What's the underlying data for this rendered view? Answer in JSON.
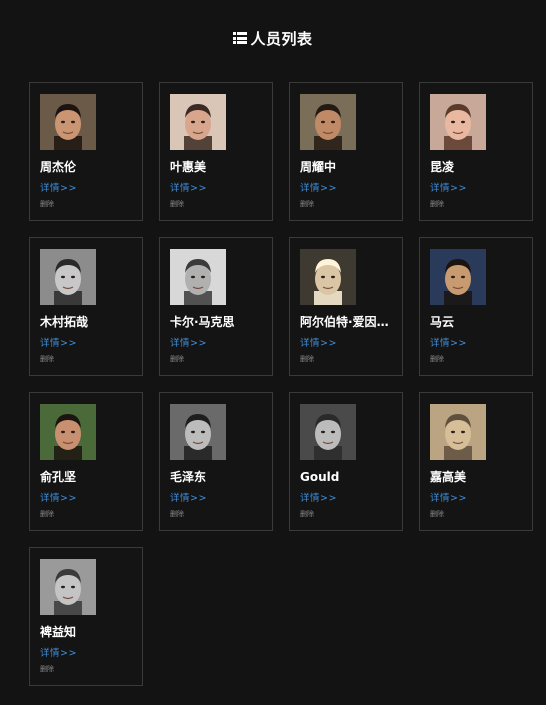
{
  "header": {
    "icon": "list-icon",
    "title": "人员列表"
  },
  "people": [
    {
      "name": "周杰伦",
      "details_label": "详情>>",
      "delete_label": "删除",
      "photo": {
        "bg": "#6b5a48",
        "skin": "#c99572",
        "hair": "#1c1410",
        "tone": "color"
      }
    },
    {
      "name": "叶惠美",
      "details_label": "详情>>",
      "delete_label": "删除",
      "photo": {
        "bg": "#d9c6b6",
        "skin": "#d8a68c",
        "hair": "#3a2a22",
        "tone": "color"
      }
    },
    {
      "name": "周耀中",
      "details_label": "详情>>",
      "delete_label": "删除",
      "photo": {
        "bg": "#7a6e58",
        "skin": "#c08a66",
        "hair": "#231a14",
        "tone": "color"
      }
    },
    {
      "name": "昆凌",
      "details_label": "详情>>",
      "delete_label": "删除",
      "photo": {
        "bg": "#c8a898",
        "skin": "#e8b8a0",
        "hair": "#5a3a2a",
        "tone": "color"
      }
    },
    {
      "name": "木村拓哉",
      "details_label": "详情>>",
      "delete_label": "删除",
      "photo": {
        "bg": "#8c8c8c",
        "skin": "#c8c8c8",
        "hair": "#2a2a2a",
        "tone": "gray"
      }
    },
    {
      "name": "卡尔·马克思",
      "details_label": "详情>>",
      "delete_label": "删除",
      "photo": {
        "bg": "#d8d8d8",
        "skin": "#b0b0b0",
        "hair": "#3a3a3a",
        "tone": "gray"
      }
    },
    {
      "name": "阿尔伯特·爱因斯坦",
      "details_label": "详情>>",
      "delete_label": "删除",
      "photo": {
        "bg": "#3a3630",
        "skin": "#c8b8a0",
        "hair": "#e8e4dc",
        "tone": "sepia"
      }
    },
    {
      "name": "马云",
      "details_label": "详情>>",
      "delete_label": "删除",
      "photo": {
        "bg": "#2a3a5a",
        "skin": "#c89a70",
        "hair": "#1a1410",
        "tone": "color"
      }
    },
    {
      "name": "俞孔坚",
      "details_label": "详情>>",
      "delete_label": "删除",
      "photo": {
        "bg": "#4a6a3a",
        "skin": "#c89070",
        "hair": "#1c1410",
        "tone": "color"
      }
    },
    {
      "name": "毛泽东",
      "details_label": "详情>>",
      "delete_label": "删除",
      "photo": {
        "bg": "#6a6a6a",
        "skin": "#bcbcbc",
        "hair": "#1e1e1e",
        "tone": "gray"
      }
    },
    {
      "name": "Gould",
      "details_label": "详情>>",
      "delete_label": "删除",
      "photo": {
        "bg": "#4a4a4a",
        "skin": "#bcbcbc",
        "hair": "#2a2a2a",
        "tone": "gray"
      }
    },
    {
      "name": "嘉高美",
      "details_label": "详情>>",
      "delete_label": "删除",
      "photo": {
        "bg": "#b09878",
        "skin": "#c8b090",
        "hair": "#5a4a38",
        "tone": "sepia"
      }
    },
    {
      "name": "裨益知",
      "details_label": "详情>>",
      "delete_label": "删除",
      "photo": {
        "bg": "#9a9a9a",
        "skin": "#c4c4c4",
        "hair": "#3a3a3a",
        "tone": "gray"
      }
    }
  ],
  "colors": {
    "background": "#131313",
    "card_border": "#3a3a3a",
    "link": "#3f8fdc",
    "delete": "#8a8a8a",
    "text": "#ffffff"
  }
}
